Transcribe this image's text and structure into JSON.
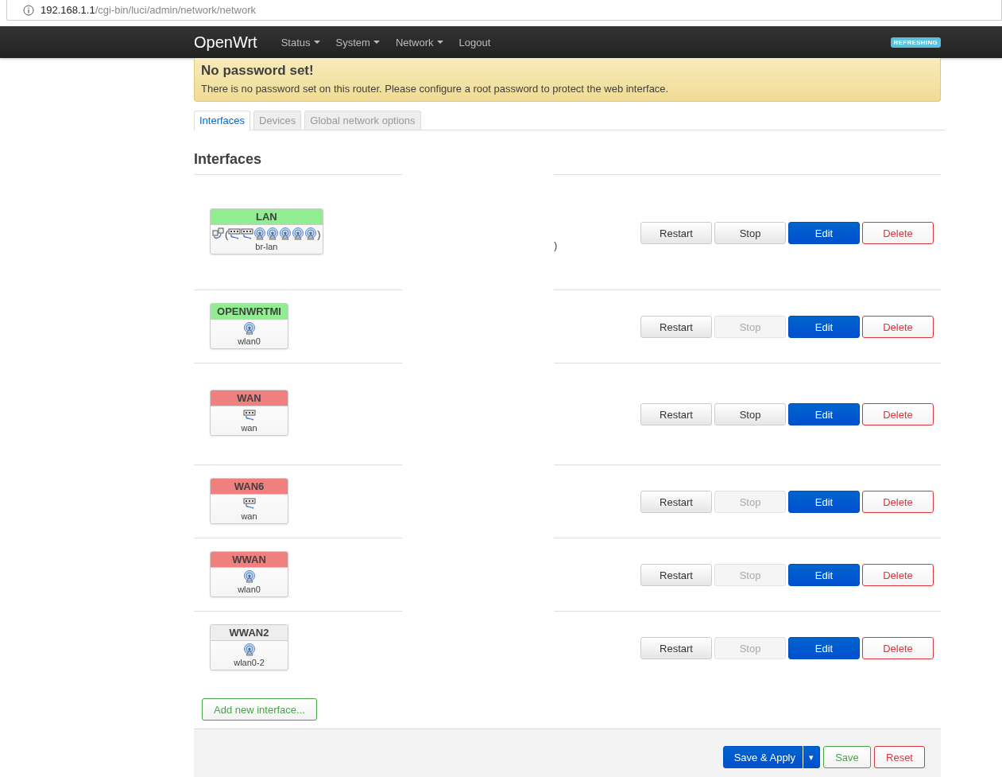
{
  "address_bar": {
    "host": "192.168.1.1",
    "path": "/cgi-bin/luci/admin/network/network"
  },
  "navbar": {
    "brand": "OpenWrt",
    "menus": [
      {
        "label": "Status",
        "dropdown": true
      },
      {
        "label": "System",
        "dropdown": true
      },
      {
        "label": "Network",
        "dropdown": true
      },
      {
        "label": "Logout",
        "dropdown": false
      }
    ],
    "badge": "REFRESHING"
  },
  "alert": {
    "title": "No password set!",
    "text": "There is no password set on this router. Please configure a root password to protect the web interface."
  },
  "tabs": [
    {
      "label": "Interfaces",
      "selected": true
    },
    {
      "label": "Devices",
      "selected": false
    },
    {
      "label": "Global network options",
      "selected": false
    }
  ],
  "section_title": "Interfaces",
  "interfaces": [
    {
      "name": "LAN",
      "color": "#90ee90",
      "device_icon": {
        "kind": "bridge"
      },
      "open": "(",
      "members": [
        {
          "kind": "ethernet"
        },
        {
          "kind": "ethernet"
        },
        {
          "kind": "wifi"
        },
        {
          "kind": "wifi"
        },
        {
          "kind": "wifi"
        },
        {
          "kind": "wifi"
        },
        {
          "kind": "wifi"
        }
      ],
      "close": ")",
      "device": "br-lan",
      "note": ")",
      "buttons": [
        {
          "label": "Restart",
          "kind": "neutral",
          "disabled": false
        },
        {
          "label": "Stop",
          "kind": "neutral",
          "disabled": false
        },
        {
          "label": "Edit",
          "kind": "primary",
          "disabled": false
        },
        {
          "label": "Delete",
          "kind": "danger",
          "disabled": false
        }
      ]
    },
    {
      "name": "OPENWRTMI",
      "color": "#90ee90",
      "device_icon": {
        "kind": "wifi"
      },
      "device": "wlan0",
      "buttons": [
        {
          "label": "Restart",
          "kind": "neutral",
          "disabled": false
        },
        {
          "label": "Stop",
          "kind": "neutral",
          "disabled": true
        },
        {
          "label": "Edit",
          "kind": "primary",
          "disabled": false
        },
        {
          "label": "Delete",
          "kind": "danger",
          "disabled": false
        }
      ]
    },
    {
      "name": "WAN",
      "color": "#f08080",
      "device_icon": {
        "kind": "ethernet"
      },
      "device": "wan",
      "buttons": [
        {
          "label": "Restart",
          "kind": "neutral",
          "disabled": false
        },
        {
          "label": "Stop",
          "kind": "neutral",
          "disabled": false
        },
        {
          "label": "Edit",
          "kind": "primary",
          "disabled": false
        },
        {
          "label": "Delete",
          "kind": "danger",
          "disabled": false
        }
      ]
    },
    {
      "name": "WAN6",
      "color": "#f08080",
      "device_icon": {
        "kind": "ethernet"
      },
      "device": "wan",
      "buttons": [
        {
          "label": "Restart",
          "kind": "neutral",
          "disabled": false
        },
        {
          "label": "Stop",
          "kind": "neutral",
          "disabled": true
        },
        {
          "label": "Edit",
          "kind": "primary",
          "disabled": false
        },
        {
          "label": "Delete",
          "kind": "danger",
          "disabled": false
        }
      ]
    },
    {
      "name": "WWAN",
      "color": "#f08080",
      "device_icon": {
        "kind": "wifi"
      },
      "device": "wlan0",
      "buttons": [
        {
          "label": "Restart",
          "kind": "neutral",
          "disabled": false
        },
        {
          "label": "Stop",
          "kind": "neutral",
          "disabled": true
        },
        {
          "label": "Edit",
          "kind": "primary",
          "disabled": false
        },
        {
          "label": "Delete",
          "kind": "danger",
          "disabled": false
        }
      ]
    },
    {
      "name": "WWAN2",
      "color": "#eeeeee",
      "device_icon": {
        "kind": "wifi"
      },
      "device": "wlan0-2",
      "buttons": [
        {
          "label": "Restart",
          "kind": "neutral",
          "disabled": false
        },
        {
          "label": "Stop",
          "kind": "neutral",
          "disabled": true
        },
        {
          "label": "Edit",
          "kind": "primary",
          "disabled": false
        },
        {
          "label": "Delete",
          "kind": "danger",
          "disabled": false
        }
      ]
    }
  ],
  "add_button": "Add new interface...",
  "footer": {
    "save_apply": "Save & Apply",
    "caret": "▾",
    "save": "Save",
    "reset": "Reset"
  }
}
